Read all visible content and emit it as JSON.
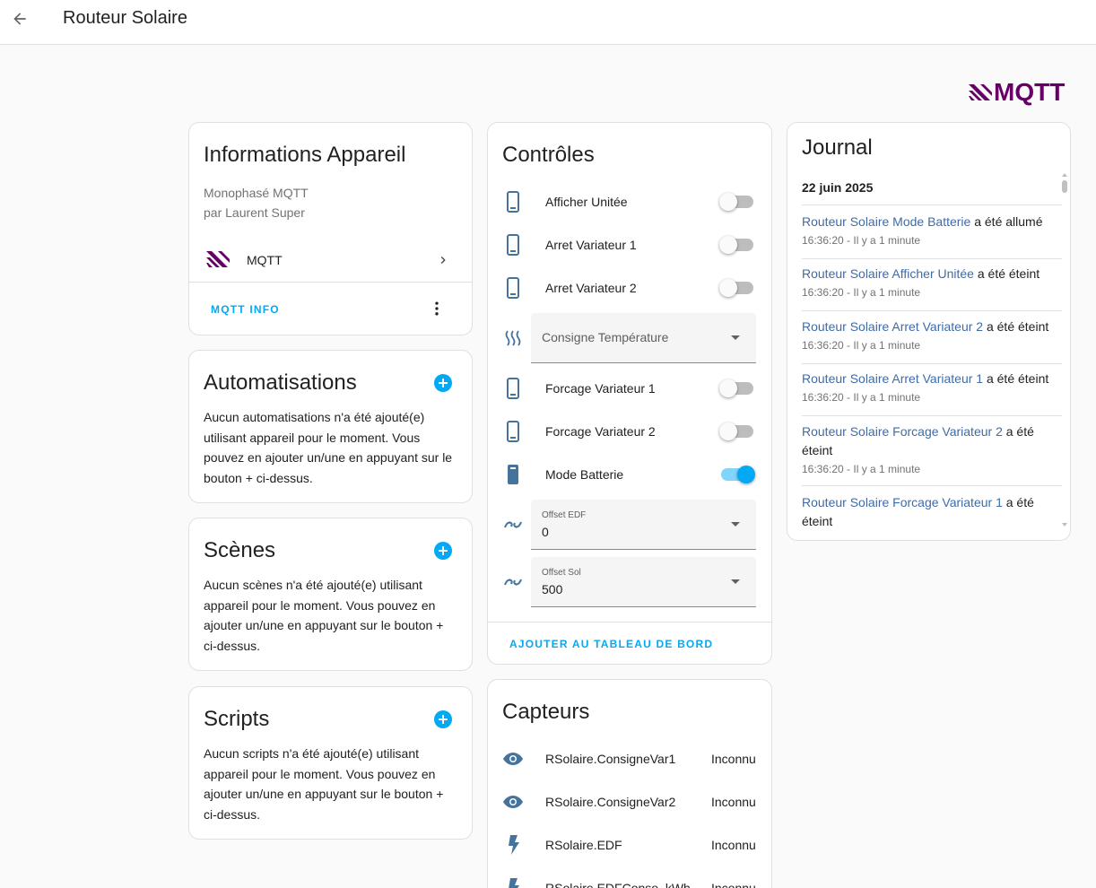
{
  "header": {
    "title": "Routeur Solaire"
  },
  "brand": {
    "logo_text": "MQTT",
    "color": "#660066"
  },
  "device_info": {
    "title": "Informations Appareil",
    "model": "Monophasé MQTT",
    "manufacturer": "par Laurent Super",
    "integration": "MQTT",
    "action": "MQTT INFO"
  },
  "automations": {
    "title": "Automatisations",
    "text": "Aucun automatisations n'a été ajouté(e) utilisant appareil pour le moment. Vous pouvez en ajouter un/une en appuyant sur le bouton + ci-dessus."
  },
  "scenes": {
    "title": "Scènes",
    "text": "Aucun scènes n'a été ajouté(e) utilisant appareil pour le moment. Vous pouvez en ajouter un/une en appuyant sur le bouton + ci-dessus."
  },
  "scripts": {
    "title": "Scripts",
    "text": "Aucun scripts n'a été ajouté(e) utilisant appareil pour le moment. Vous pouvez en ajouter un/une en appuyant sur le bouton + ci-dessus."
  },
  "controls": {
    "title": "Contrôles",
    "items": [
      {
        "label": "Afficher Unitée",
        "on": false
      },
      {
        "label": "Arret Variateur 1",
        "on": false
      },
      {
        "label": "Arret Variateur 2",
        "on": false
      },
      {
        "label": "Consigne Température"
      },
      {
        "label": "Forcage Variateur 1",
        "on": false
      },
      {
        "label": "Forcage Variateur 2",
        "on": false
      },
      {
        "label": "Mode Batterie",
        "on": true
      },
      {
        "label": "Offset EDF",
        "value": "0"
      },
      {
        "label": "Offset Sol",
        "value": "500"
      }
    ],
    "action": "AJOUTER AU TABLEAU DE BORD"
  },
  "sensors": {
    "title": "Capteurs",
    "items": [
      {
        "label": "RSolaire.ConsigneVar1",
        "value": "Inconnu"
      },
      {
        "label": "RSolaire.ConsigneVar2",
        "value": "Inconnu"
      },
      {
        "label": "RSolaire.EDF",
        "value": "Inconnu"
      },
      {
        "label": "RSolaire.EDFConso_kWh",
        "value": "Inconnu"
      }
    ]
  },
  "journal": {
    "title": "Journal",
    "date": "22 juin 2025",
    "entries": [
      {
        "entity": "Routeur Solaire Mode Batterie",
        "action": " a été allumé",
        "time": "16:36:20 - Il y a 1 minute"
      },
      {
        "entity": "Routeur Solaire Afficher Unitée",
        "action": " a été éteint",
        "time": "16:36:20 - Il y a 1 minute"
      },
      {
        "entity": "Routeur Solaire Arret Variateur 2",
        "action": " a été éteint",
        "time": "16:36:20 - Il y a 1 minute"
      },
      {
        "entity": "Routeur Solaire Arret Variateur 1",
        "action": " a été éteint",
        "time": "16:36:20 - Il y a 1 minute"
      },
      {
        "entity": "Routeur Solaire Forcage Variateur 2",
        "action": " a été éteint",
        "time": "16:36:20 - Il y a 1 minute"
      },
      {
        "entity": "Routeur Solaire Forcage Variateur 1",
        "action": " a été éteint",
        "time": ""
      }
    ]
  },
  "colors": {
    "accent": "#03a9f4",
    "link": "#3f6ba8",
    "icon": "#44739e"
  }
}
